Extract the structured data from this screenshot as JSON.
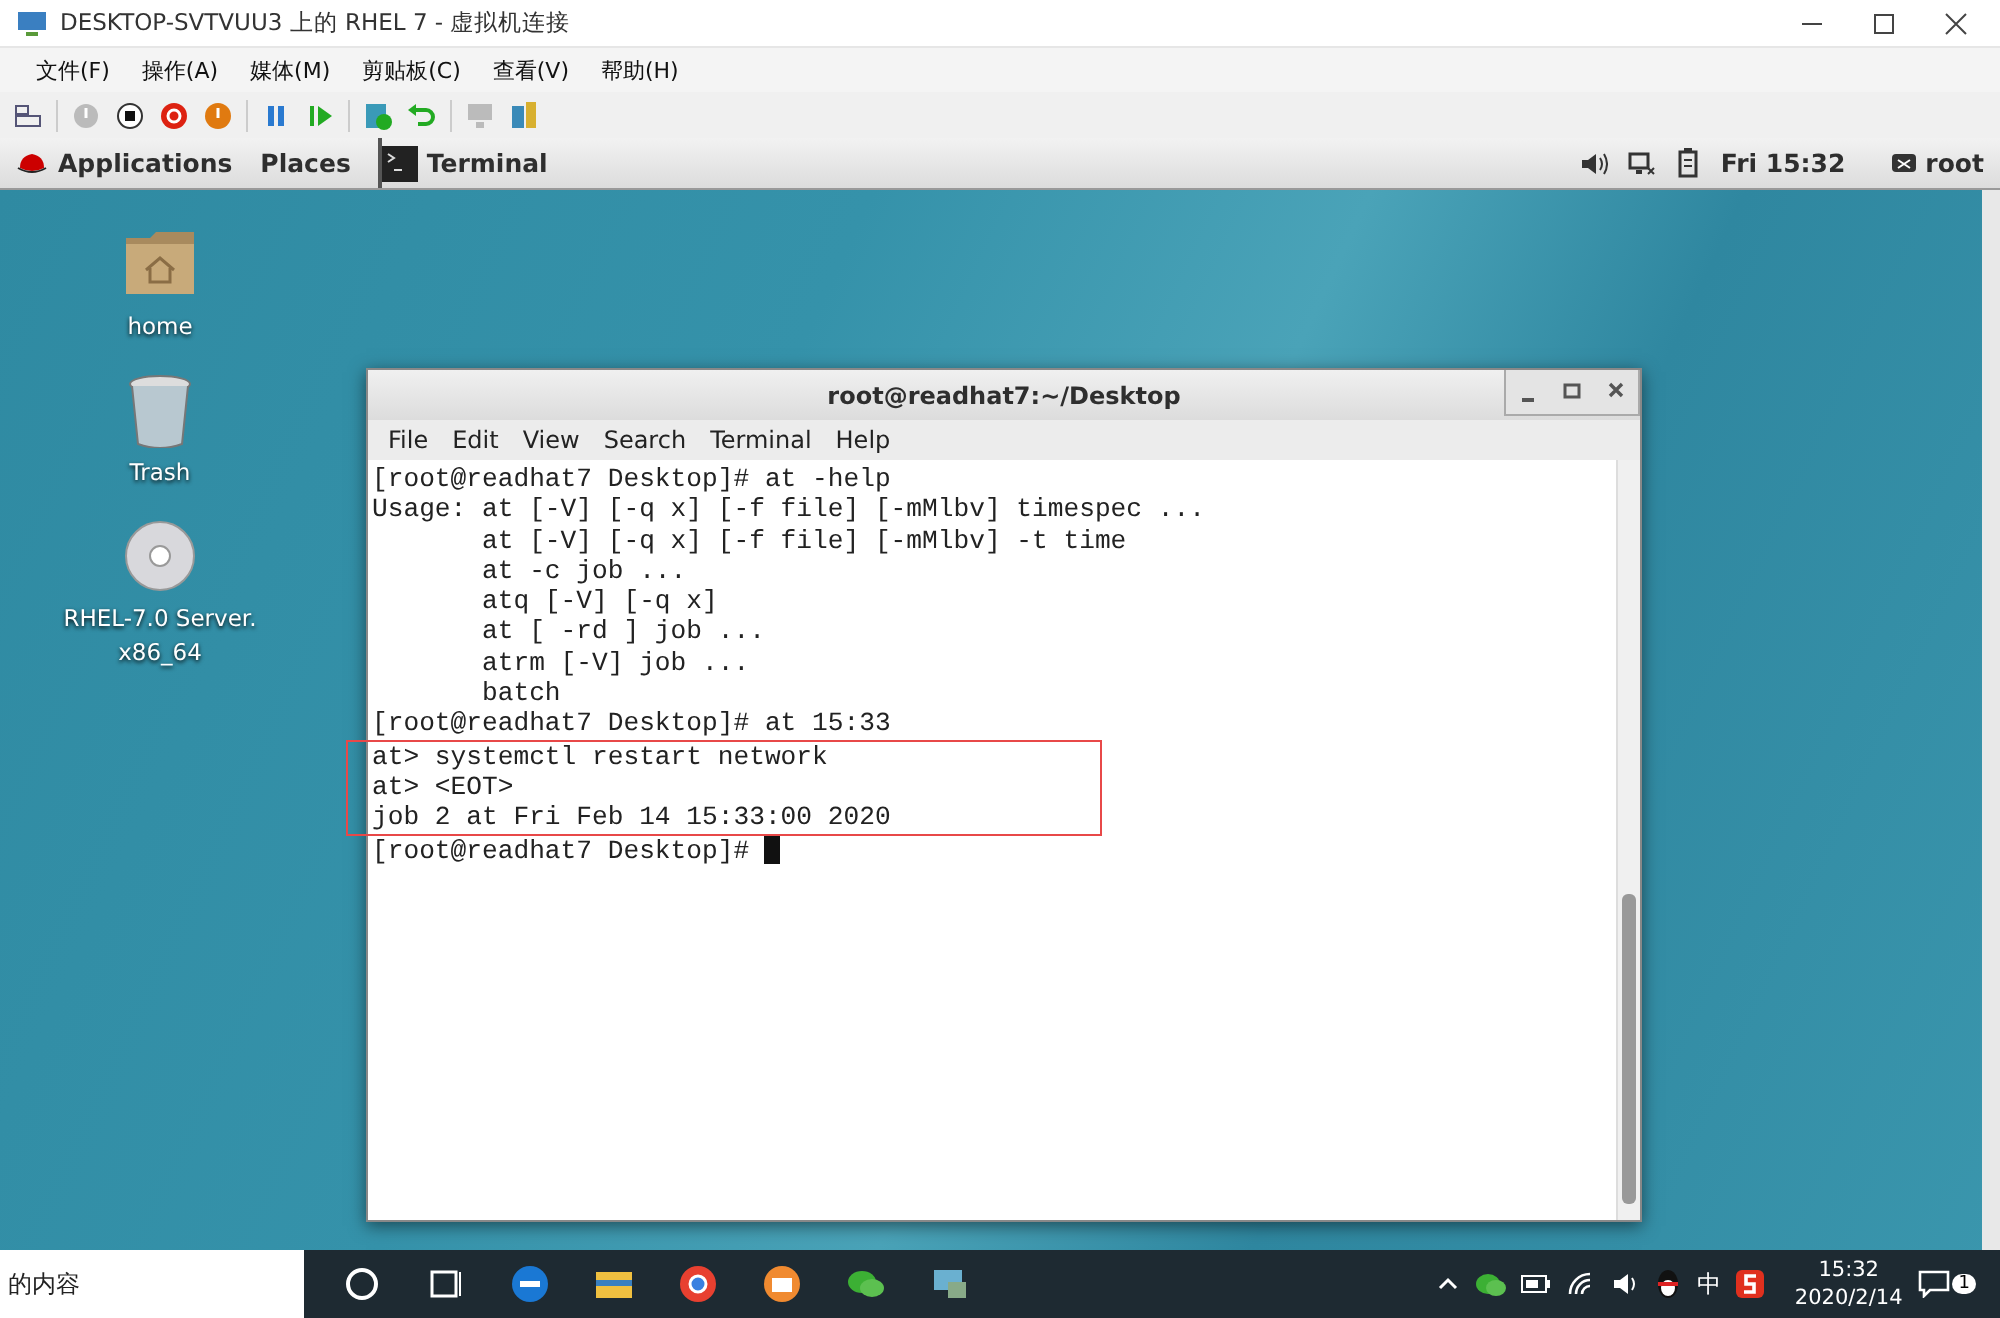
{
  "window": {
    "title": "DESKTOP-SVTVUU3 上的 RHEL 7 - 虚拟机连接"
  },
  "menu": [
    "文件(F)",
    "操作(A)",
    "媒体(M)",
    "剪贴板(C)",
    "查看(V)",
    "帮助(H)"
  ],
  "gnome_bar": {
    "applications": "Applications",
    "places": "Places",
    "task": "Terminal",
    "clock": "Fri 15:32",
    "user": "root"
  },
  "desktop_icons": [
    {
      "kind": "folder",
      "label": "home"
    },
    {
      "kind": "trash",
      "label": "Trash"
    },
    {
      "kind": "disc",
      "label": "RHEL-7.0 Server.\nx86_64"
    }
  ],
  "terminal": {
    "title": "root@readhat7:~/Desktop",
    "menu": [
      "File",
      "Edit",
      "View",
      "Search",
      "Terminal",
      "Help"
    ],
    "lines": [
      {
        "text": "[root@readhat7 Desktop]# at -help",
        "highlighted": false,
        "cursor": false
      },
      {
        "text": "Usage: at [-V] [-q x] [-f file] [-mMlbv] timespec ...",
        "highlighted": false,
        "cursor": false
      },
      {
        "text": "       at [-V] [-q x] [-f file] [-mMlbv] -t time",
        "highlighted": false,
        "cursor": false
      },
      {
        "text": "       at -c job ...",
        "highlighted": false,
        "cursor": false
      },
      {
        "text": "       atq [-V] [-q x]",
        "highlighted": false,
        "cursor": false
      },
      {
        "text": "       at [ -rd ] job ...",
        "highlighted": false,
        "cursor": false
      },
      {
        "text": "       atrm [-V] job ...",
        "highlighted": false,
        "cursor": false
      },
      {
        "text": "       batch",
        "highlighted": false,
        "cursor": false
      },
      {
        "text": "[root@readhat7 Desktop]# at 15:33",
        "highlighted": false,
        "cursor": false
      },
      {
        "text": "at> systemctl restart network",
        "highlighted": true,
        "cursor": false
      },
      {
        "text": "at> <EOT>",
        "highlighted": true,
        "cursor": false
      },
      {
        "text": "job 2 at Fri Feb 14 15:33:00 2020",
        "highlighted": true,
        "cursor": false
      },
      {
        "text": "[root@readhat7 Desktop]# ",
        "highlighted": false,
        "cursor": true
      }
    ]
  },
  "taskbar": {
    "search_text": "的内容",
    "input_method": "中",
    "time": "15:32",
    "date": "2020/2/14",
    "notifications": "1"
  }
}
